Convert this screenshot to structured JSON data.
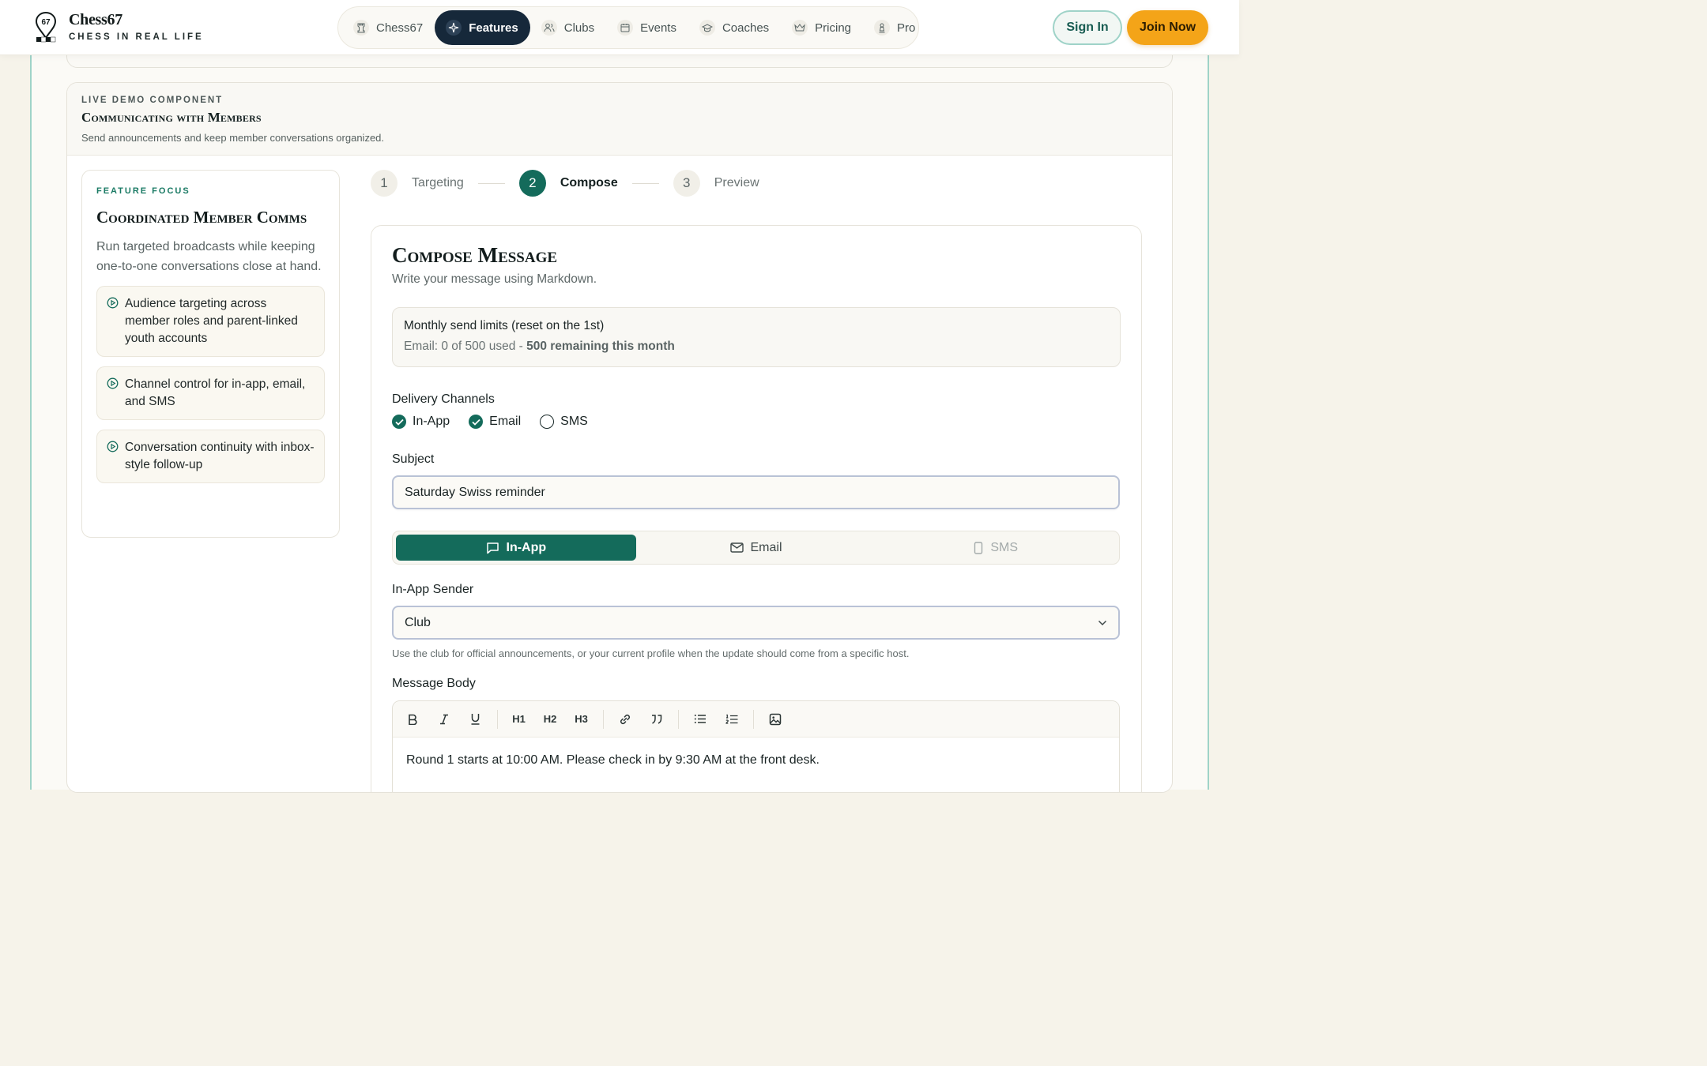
{
  "header": {
    "brand_name": "Chess67",
    "brand_tagline": "CHESS IN REAL LIFE",
    "nav": [
      {
        "label": "Chess67",
        "icon": "rook-icon"
      },
      {
        "label": "Features",
        "icon": "sparkle-icon"
      },
      {
        "label": "Clubs",
        "icon": "users-icon"
      },
      {
        "label": "Events",
        "icon": "calendar-icon"
      },
      {
        "label": "Coaches",
        "icon": "graduation-cap-icon"
      },
      {
        "label": "Pricing",
        "icon": "crown-icon"
      },
      {
        "label": "Pro",
        "icon": "pawn-icon"
      }
    ],
    "active_nav": "Features",
    "sign_in": "Sign In",
    "join_now": "Join Now"
  },
  "demo": {
    "eyebrow": "LIVE DEMO COMPONENT",
    "title": "Communicating with Members",
    "subtitle": "Send announcements and keep member conversations organized."
  },
  "focus": {
    "eyebrow": "FEATURE FOCUS",
    "title": "Coordinated Member Comms",
    "description": "Run targeted broadcasts while keeping one-to-one conversations close at hand.",
    "features": [
      "Audience targeting across member roles and parent-linked youth accounts",
      "Channel control for in-app, email, and SMS",
      "Conversation continuity with inbox-style follow-up"
    ]
  },
  "steps": [
    {
      "num": "1",
      "label": "Targeting"
    },
    {
      "num": "2",
      "label": "Compose"
    },
    {
      "num": "3",
      "label": "Preview"
    }
  ],
  "compose": {
    "title": "Compose Message",
    "subtitle": "Write your message using Markdown.",
    "limits_title": "Monthly send limits (reset on the 1st)",
    "limits_used": "Email: 0 of 500 used - ",
    "limits_remaining": "500 remaining this month",
    "channels_label": "Delivery Channels",
    "channels": [
      {
        "label": "In-App",
        "checked": true
      },
      {
        "label": "Email",
        "checked": true
      },
      {
        "label": "SMS",
        "checked": false
      }
    ],
    "subject_label": "Subject",
    "subject_value": "Saturday Swiss reminder",
    "tabs": [
      {
        "label": "In-App",
        "icon": "chat-bubble-icon"
      },
      {
        "label": "Email",
        "icon": "envelope-icon"
      },
      {
        "label": "SMS",
        "icon": "phone-icon"
      }
    ],
    "sender_label": "In-App Sender",
    "sender_value": "Club",
    "sender_hint": "Use the club for official announcements, or your current profile when the update should come from a specific host.",
    "body_label": "Message Body",
    "body_text": "Round 1 starts at 10:00 AM. Please check in by 9:30 AM at the front desk.",
    "toolbar": {
      "h1": "H1",
      "h2": "H2",
      "h3": "H3"
    }
  },
  "colors": {
    "primary": "#146b5b",
    "accent": "#f4a418",
    "nav_active": "#16283a",
    "frame_border": "#9fd3c8"
  }
}
